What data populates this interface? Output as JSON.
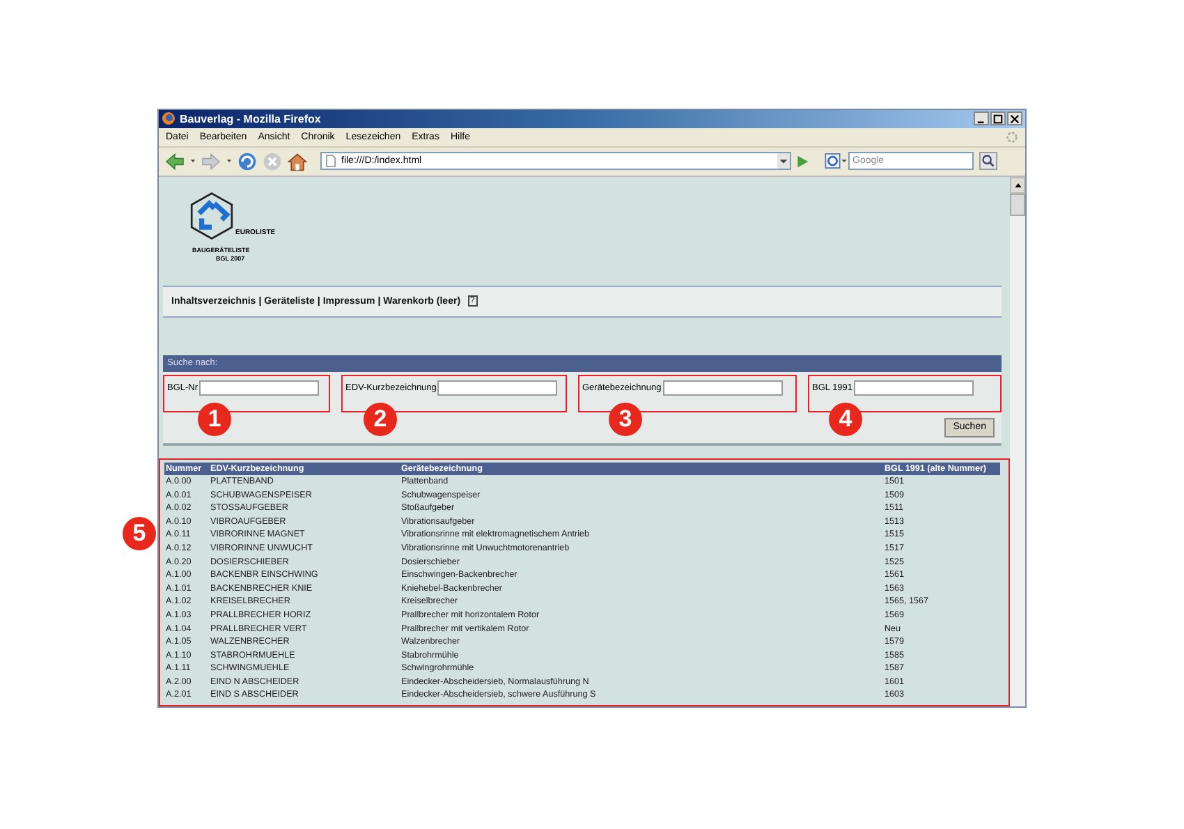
{
  "window": {
    "title": "Bauverlag - Mozilla Firefox"
  },
  "menu": [
    "Datei",
    "Bearbeiten",
    "Ansicht",
    "Chronik",
    "Lesezeichen",
    "Extras",
    "Hilfe"
  ],
  "toolbar": {
    "address": "file:///D:/index.html",
    "search_placeholder": "Google"
  },
  "logo": {
    "brand": "EUROLISTE",
    "subtitle": "BAUGERÄTELISTE",
    "edition": "BGL 2007"
  },
  "nav": [
    "Inhaltsverzeichnis",
    "Geräteliste",
    "Impressum",
    "Warenkorb (leer)"
  ],
  "nav_separator": "|",
  "nav_help": "?",
  "search": {
    "title": "Suche nach:",
    "fields": [
      {
        "label": "BGL-Nr",
        "callout": "1"
      },
      {
        "label": "EDV-Kurzbezeichnung",
        "callout": "2"
      },
      {
        "label": "Gerätebezeichnung",
        "callout": "3"
      },
      {
        "label": "BGL 1991",
        "callout": "4"
      }
    ],
    "button": "Suchen"
  },
  "table": {
    "callout": "5",
    "columns": [
      "Nummer",
      "EDV-Kurzbezeichnung",
      "Gerätebezeichnung",
      "BGL 1991 (alte Nummer)"
    ],
    "rows": [
      [
        "A.0.00",
        "PLATTENBAND",
        "Plattenband",
        "1501"
      ],
      [
        "A.0.01",
        "SCHUBWAGENSPEISER",
        "Schubwagenspeiser",
        "1509"
      ],
      [
        "A.0.02",
        "STOSSAUFGEBER",
        "Stoßaufgeber",
        "1511"
      ],
      [
        "A.0.10",
        "VIBROAUFGEBER",
        "Vibrationsaufgeber",
        "1513"
      ],
      [
        "A.0.11",
        "VIBRORINNE MAGNET",
        "Vibrationsrinne mit elektromagnetischem Antrieb",
        "1515"
      ],
      [
        "A.0.12",
        "VIBRORINNE UNWUCHT",
        "Vibrationsrinne mit Unwuchtmotorenantrieb",
        "1517"
      ],
      [
        "A.0.20",
        "DOSIERSCHIEBER",
        "Dosierschieber",
        "1525"
      ],
      [
        "A.1.00",
        "BACKENBR EINSCHWING",
        "Einschwingen-Backenbrecher",
        "1561"
      ],
      [
        "A.1.01",
        "BACKENBRECHER KNIE",
        "Kniehebel-Backenbrecher",
        "1563"
      ],
      [
        "A.1.02",
        "KREISELBRECHER",
        "Kreiselbrecher",
        "1565, 1567"
      ],
      [
        "A.1.03",
        "PRALLBRECHER HORIZ",
        "Prallbrecher mit horizontalem Rotor",
        "1569"
      ],
      [
        "A.1.04",
        "PRALLBRECHER VERT",
        "Prallbrecher mit vertikalem Rotor",
        "Neu"
      ],
      [
        "A.1.05",
        "WALZENBRECHER",
        "Walzenbrecher",
        "1579"
      ],
      [
        "A.1.10",
        "STABROHRMUEHLE",
        "Stabrohrmühle",
        "1585"
      ],
      [
        "A.1.11",
        "SCHWINGMUEHLE",
        "Schwingrohrmühle",
        "1587"
      ],
      [
        "A.2.00",
        "EIND N ABSCHEIDER",
        "Eindecker-Abscheidersieb, Normalausführung N",
        "1601"
      ],
      [
        "A.2.01",
        "EIND S ABSCHEIDER",
        "Eindecker-Abscheidersieb, schwere Ausführung S",
        "1603"
      ]
    ]
  }
}
